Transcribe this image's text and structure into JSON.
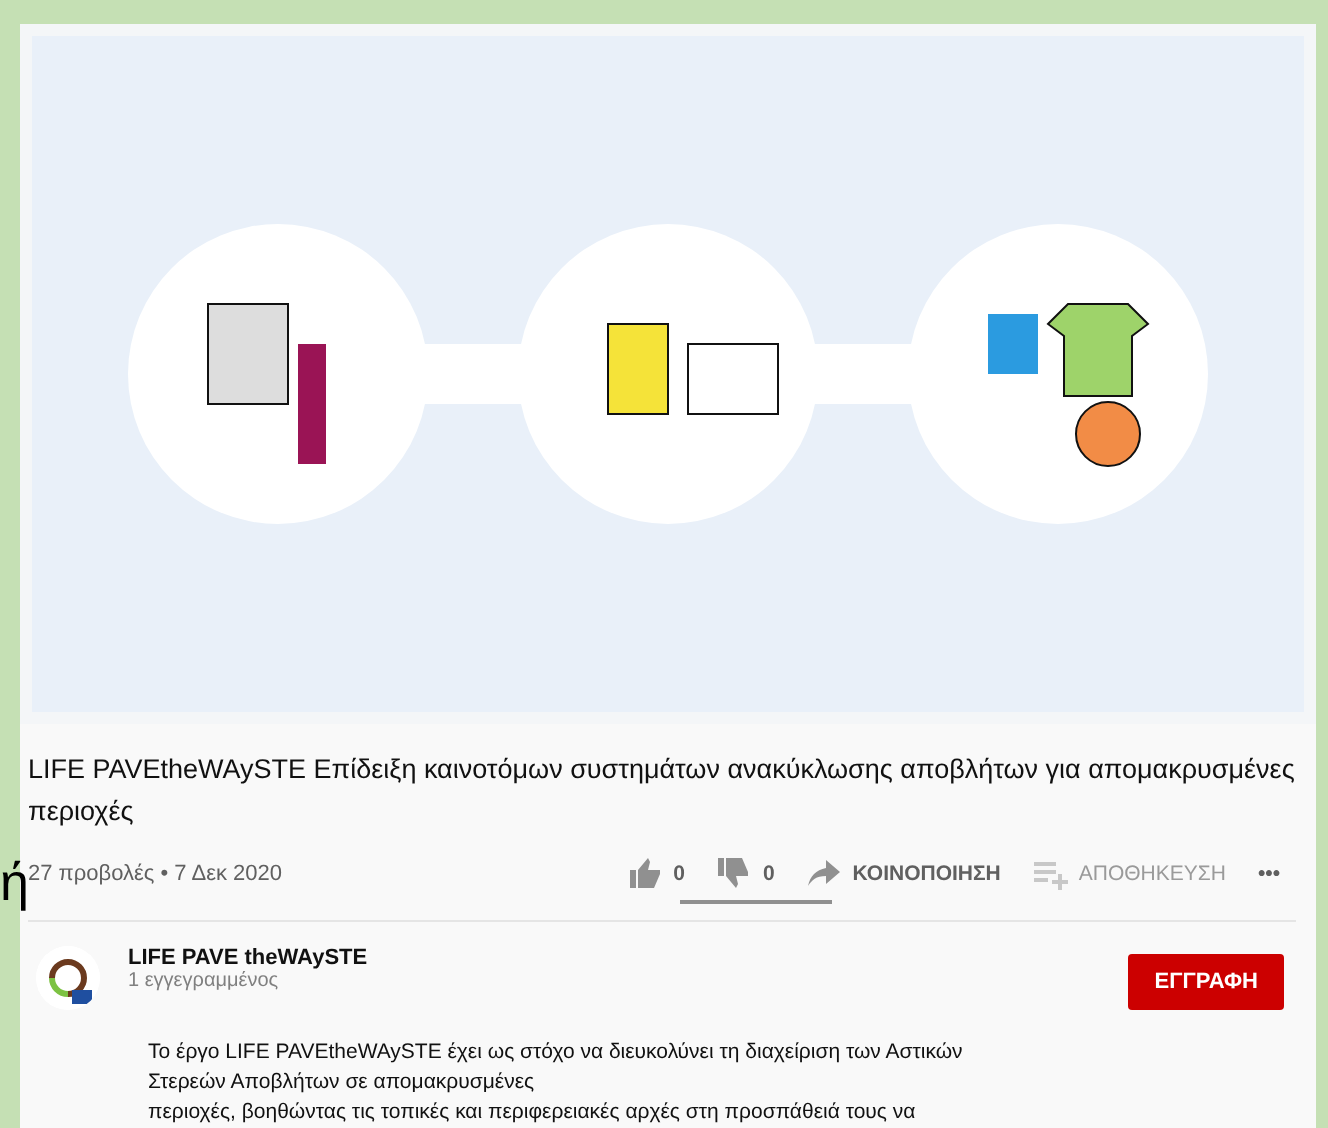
{
  "video": {
    "title": "LIFE PAVEtheWAySTE Επίδειξη καινοτόμων συστημάτων ανακύκλωσης αποβλήτων για απομακρυσμένες περιοχές",
    "meta": "27 προβολές • 7 Δεκ 2020"
  },
  "actions": [
    {
      "kind": "like",
      "label": "0",
      "disabled": false
    },
    {
      "kind": "dislike",
      "label": "0",
      "disabled": false
    },
    {
      "kind": "share",
      "label": "ΚΟΙΝΟΠΟΙΗΣΗ",
      "disabled": false
    },
    {
      "kind": "save",
      "label": "ΑΠΟΘΗΚΕΥΣΗ",
      "disabled": true
    },
    {
      "kind": "more",
      "label": "•••",
      "disabled": false
    }
  ],
  "background_fragment": "ή",
  "channel": {
    "name": "LIFE PAVE theWAySTE",
    "subscribers": "1 εγγεγραμμένος",
    "subscribe_button": "ΕΓΓΡΑΦΗ"
  },
  "description": [
    "Το έργο LIFE PAVEtheWAySTE έχει ως στόχο να διευκολύνει τη διαχείριση των Αστικών",
    "Στερεών Αποβλήτων σε απομακρυσμένες",
    "περιοχές, βοηθώντας τις τοπικές και περιφερειακές αρχές στη προσπάθειά τους να"
  ]
}
